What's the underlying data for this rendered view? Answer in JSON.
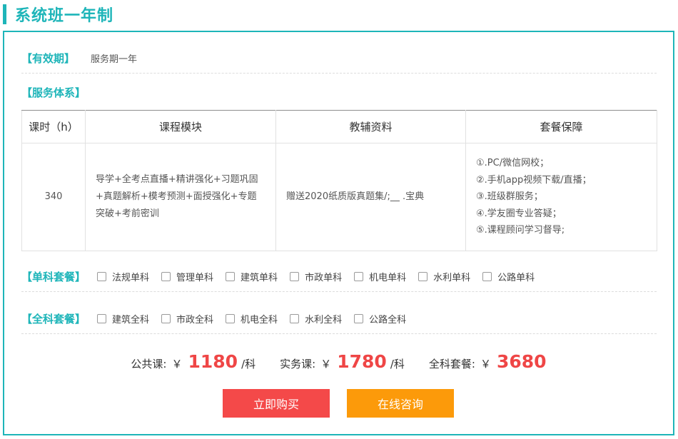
{
  "header": {
    "title": "系统班一年制"
  },
  "validity": {
    "label": "【有效期】",
    "value": "服务期一年"
  },
  "service": {
    "label": "【服务体系】",
    "table": {
      "headers": [
        "课时（h）",
        "课程模块",
        "教辅资料",
        "套餐保障"
      ],
      "hours": "340",
      "course": "导学+全考点直播+精讲强化+习题巩固+真题解析+模考预测+面授强化+专题突破+考前密训",
      "material": "赠送2020纸质版真题集/;__ .宝典",
      "guarantee": [
        "①.PC/微信网校；",
        "②.手机app视频下载/直播；",
        "③.班级群服务；",
        "④.学友圈专业答疑；",
        "⑤.课程顾问学习督导;"
      ]
    }
  },
  "single_package": {
    "label": "【单科套餐】",
    "options": [
      "法规单科",
      "管理单科",
      "建筑单科",
      "市政单科",
      "机电单科",
      "水利单科",
      "公路单科"
    ]
  },
  "full_package": {
    "label": "【全科套餐】",
    "options": [
      "建筑全科",
      "市政全科",
      "机电全科",
      "水利全科",
      "公路全科"
    ]
  },
  "prices": {
    "currency": "￥",
    "public": {
      "label": "公共课:",
      "amount": "1180",
      "unit": "/科"
    },
    "practice": {
      "label": "实务课:",
      "amount": "1780",
      "unit": "/科"
    },
    "full": {
      "label": "全科套餐:",
      "amount": "3680"
    }
  },
  "actions": {
    "buy_label": "立即购买",
    "consult_label": "在线咨询"
  },
  "colors": {
    "accent": "#1eb5b9",
    "price": "#ef4646",
    "buy": "#f44949",
    "consult": "#fc9a0a"
  }
}
